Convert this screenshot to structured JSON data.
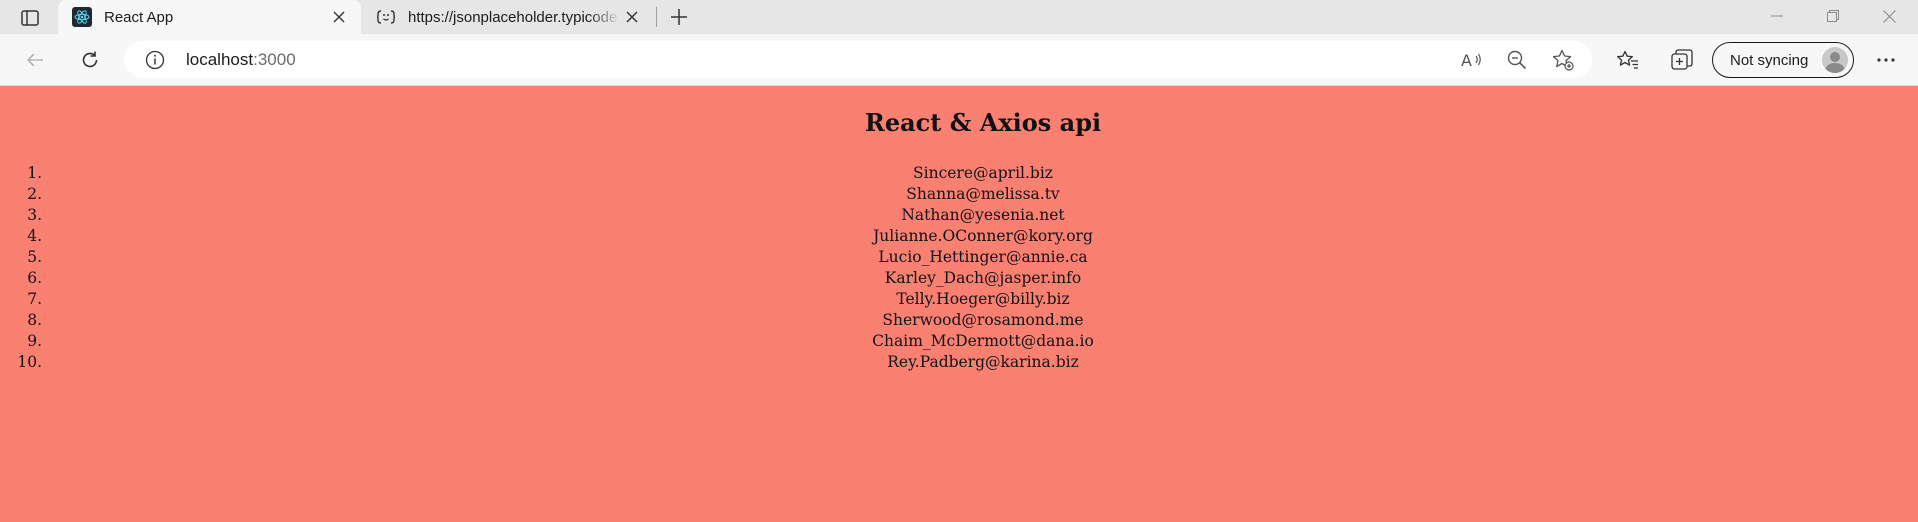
{
  "browser": {
    "tabs": [
      {
        "title": "React App",
        "active": true,
        "icon": "react-icon"
      },
      {
        "title": "https://jsonplaceholder.typicode.com/users",
        "active": false,
        "icon": "json-page-icon"
      }
    ],
    "address": {
      "host": "localhost",
      "port": ":3000"
    },
    "profile_label": "Not syncing"
  },
  "page": {
    "heading": "React & Axios api",
    "emails": [
      {
        "n": "1.",
        "email": "Sincere@april.biz"
      },
      {
        "n": "2.",
        "email": "Shanna@melissa.tv"
      },
      {
        "n": "3.",
        "email": "Nathan@yesenia.net"
      },
      {
        "n": "4.",
        "email": "Julianne.OConner@kory.org"
      },
      {
        "n": "5.",
        "email": "Lucio_Hettinger@annie.ca"
      },
      {
        "n": "6.",
        "email": "Karley_Dach@jasper.info"
      },
      {
        "n": "7.",
        "email": "Telly.Hoeger@billy.biz"
      },
      {
        "n": "8.",
        "email": "Sherwood@rosamond.me"
      },
      {
        "n": "9.",
        "email": "Chaim_McDermott@dana.io"
      },
      {
        "n": "10.",
        "email": "Rey.Padberg@karina.biz"
      }
    ]
  },
  "colors": {
    "page_background": "#fa8072",
    "react_icon_bg": "#1f2a30",
    "react_icon_fg": "#61dafb"
  }
}
